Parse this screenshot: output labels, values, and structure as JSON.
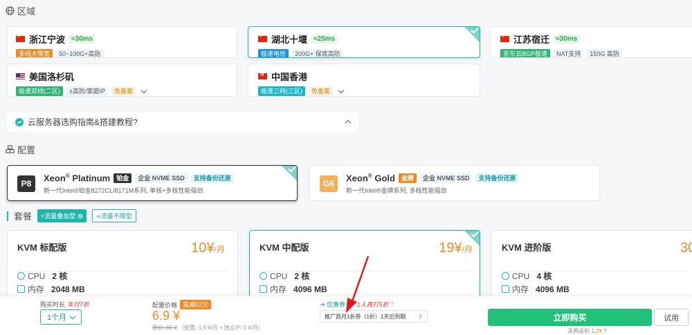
{
  "sections": {
    "region": "区域",
    "config": "配置",
    "package": "套餐"
  },
  "regions": [
    {
      "name": "浙江宁波",
      "latency": "≈30ms",
      "tags": [
        "多线大带宽",
        "50~100G+高防"
      ]
    },
    {
      "name": "湖北十堰",
      "latency": "≈25ms",
      "tags": [
        "极速电信",
        "200G+ 保底高防"
      ]
    },
    {
      "name": "江苏宿迁",
      "latency": "≈30ms",
      "tags": [
        "京东云BGP极速",
        "NAT支持",
        "150G 高防"
      ]
    },
    {
      "name": "美国洛杉矶",
      "latency": "",
      "tags": [
        "极速双线(二区)",
        "±高防/家庭IP",
        "免备案"
      ]
    },
    {
      "name": "中国香港",
      "latency": "",
      "tags": [
        "极速三网(三区)",
        "免备案"
      ]
    }
  ],
  "guide": {
    "text": "云服务器选购指南&搭建教程?"
  },
  "cpus": [
    {
      "badge": "P8",
      "name": "Xeon",
      "reg": "®",
      "model": "Platinum",
      "tier": "铂金",
      "ssd": "企业 NVME SSD",
      "backup": "支持备份还原",
      "desc": "新一代Intel®铂金8272CL/8171M系列, 单核+多核性能强劲"
    },
    {
      "badge": "G6",
      "name": "Xeon",
      "reg": "®",
      "model": "Gold",
      "tier": "金牌",
      "ssd": "企业 NVME SSD",
      "backup": "支持备份还原",
      "desc": "新一代Intel®金牌系列, 多核性能强劲"
    }
  ],
  "package_filters": {
    "plus": "+流量叠加型",
    "unlimited": "∞流量不限型"
  },
  "plans": [
    {
      "name": "KVM 标配版",
      "price": "10¥",
      "unit": "/月",
      "cpu_label": "CPU",
      "cpu": "2 核",
      "mem_label": "内存",
      "mem": "2048 MB"
    },
    {
      "name": "KVM 中配版",
      "price": "19¥",
      "unit": "/月",
      "cpu_label": "CPU",
      "cpu": "2 核",
      "mem_label": "内存",
      "mem": "4096 MB"
    },
    {
      "name": "KVM 进阶版",
      "price": "30",
      "unit": "",
      "cpu_label": "CPU",
      "cpu": "4 核",
      "mem_label": "内存",
      "mem": "4096 MB"
    }
  ],
  "footer": {
    "duration_label": "购买时长",
    "duration_promo": "年付7折",
    "duration_value": "1个月",
    "price_label": "配置价格",
    "price_badge": "直减62元",
    "price": "6.9 ¥",
    "original": "原价: 69 ¥",
    "breakdown": "（配置: 1.9 ¥/月 + 独立IP: 5 ¥/月）",
    "coupon_label": "优惠券",
    "coupon_promo": "1人再打5折",
    "coupon_value": "推广首月1折券（1折）1天后到期",
    "buy": "立即购买",
    "trial": "试用",
    "rebate": "消费返利",
    "rebate_value": "1.2¥"
  },
  "colors": {
    "accent": "#1fb5ad",
    "price": "#f08a24",
    "buy": "#22c17a",
    "arrow": "#e01b1b"
  }
}
